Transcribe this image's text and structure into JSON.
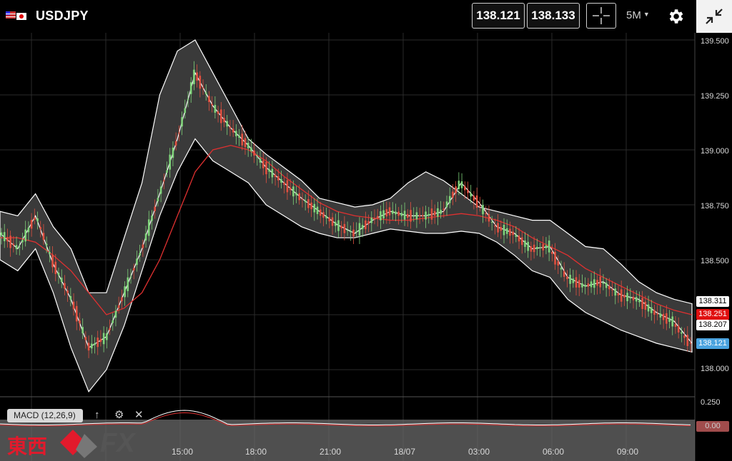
{
  "header": {
    "symbol": "USDJPY",
    "bid": "138.121",
    "ask": "138.133",
    "timeframe": "5M"
  },
  "chart_data": {
    "type": "line",
    "title": "",
    "ylim": [
      138.0,
      139.5
    ],
    "y_ticks": [
      "139.500",
      "139.250",
      "139.000",
      "138.750",
      "138.500",
      "138.000"
    ],
    "x_ticks": [
      "15:00",
      "18:00",
      "21:00",
      "18/07",
      "03:00",
      "06:00",
      "09:00"
    ],
    "price_tags": [
      "138.311",
      "138.251",
      "138.207",
      "138.121"
    ],
    "macd_ticks": [
      "0.250"
    ],
    "series": [
      {
        "values": [
          138.62,
          138.55,
          138.7,
          138.48,
          138.32,
          138.1,
          138.15,
          138.35,
          138.55,
          138.8,
          139.05,
          139.35,
          139.2,
          139.1,
          139.02,
          138.92,
          138.85,
          138.78,
          138.72,
          138.66,
          138.62,
          138.68,
          138.72,
          138.7,
          138.7,
          138.72,
          138.85,
          138.76,
          138.65,
          138.62,
          138.55,
          138.56,
          138.42,
          138.38,
          138.4,
          138.34,
          138.32,
          138.26,
          138.22,
          138.12
        ]
      },
      {
        "values": [
          138.72,
          138.7,
          138.8,
          138.65,
          138.55,
          138.35,
          138.35,
          138.6,
          138.85,
          139.25,
          139.45,
          139.5,
          139.35,
          139.2,
          139.05,
          138.98,
          138.92,
          138.86,
          138.78,
          138.76,
          138.74,
          138.75,
          138.78,
          138.85,
          138.9,
          138.86,
          138.8,
          138.74,
          138.72,
          138.7,
          138.68,
          138.68,
          138.62,
          138.56,
          138.55,
          138.48,
          138.4,
          138.35,
          138.32,
          138.3
        ]
      },
      {
        "values": [
          138.5,
          138.45,
          138.55,
          138.35,
          138.1,
          137.9,
          138.0,
          138.2,
          138.45,
          138.7,
          138.9,
          139.05,
          138.95,
          138.9,
          138.85,
          138.75,
          138.7,
          138.65,
          138.62,
          138.6,
          138.6,
          138.62,
          138.64,
          138.63,
          138.62,
          138.62,
          138.63,
          138.62,
          138.58,
          138.52,
          138.45,
          138.42,
          138.32,
          138.26,
          138.22,
          138.18,
          138.15,
          138.12,
          138.1,
          138.08
        ]
      },
      {
        "values": [
          138.6,
          138.6,
          138.58,
          138.52,
          138.45,
          138.35,
          138.25,
          138.28,
          138.35,
          138.5,
          138.7,
          138.9,
          139.0,
          139.02,
          139.0,
          138.95,
          138.88,
          138.82,
          138.76,
          138.72,
          138.7,
          138.69,
          138.68,
          138.68,
          138.69,
          138.7,
          138.71,
          138.7,
          138.68,
          138.65,
          138.6,
          138.56,
          138.52,
          138.46,
          138.42,
          138.38,
          138.34,
          138.3,
          138.27,
          138.25
        ]
      }
    ]
  },
  "macd": {
    "label": "MACD (12,26,9)",
    "value_tag": "0.00"
  },
  "logo": {
    "text": "東西",
    "fx": "FX"
  },
  "colors": {
    "background": "#000000",
    "band": "#3a3a3a",
    "ma_red": "#e03030",
    "bid_tag": "#4aa3df",
    "red_tag": "#e01010"
  }
}
